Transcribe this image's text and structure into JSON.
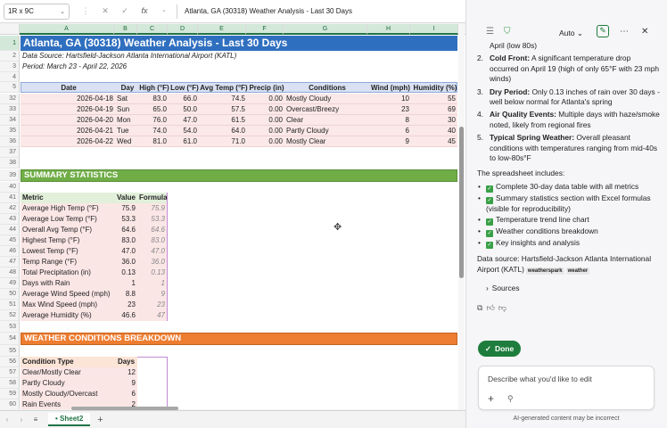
{
  "formula_bar": {
    "name_box": "1R x 9C",
    "formula": "Atlanta, GA (30318) Weather Analysis - Last 30 Days"
  },
  "columns": [
    "A",
    "B",
    "C",
    "D",
    "E",
    "F",
    "G",
    "H",
    "I"
  ],
  "rows": {
    "title": {
      "num": "1",
      "text": "Atlanta, GA (30318) Weather Analysis - Last 30 Days"
    },
    "source": {
      "num": "2",
      "text": "Data Source: Hartsfield-Jackson Atlanta International Airport (KATL)"
    },
    "period": {
      "num": "3",
      "text": "Period: March 23 - April 22, 2026"
    },
    "blank4": {
      "num": "4"
    },
    "header": {
      "num": "5",
      "cols": [
        "Date",
        "Day",
        "High (°F)",
        "Low (°F)",
        "Avg Temp (°F)",
        "Precip (in)",
        "Conditions",
        "Wind (mph)",
        "Humidity (%)"
      ]
    },
    "data": [
      {
        "num": "32",
        "date": "2026-04-18",
        "day": "Sat",
        "high": "83.0",
        "low": "66.0",
        "avg": "74.5",
        "precip": "0.00",
        "cond": "Mostly Cloudy",
        "wind": "10",
        "hum": "55"
      },
      {
        "num": "33",
        "date": "2026-04-19",
        "day": "Sun",
        "high": "65.0",
        "low": "50.0",
        "avg": "57.5",
        "precip": "0.00",
        "cond": "Overcast/Breezy",
        "wind": "23",
        "hum": "69"
      },
      {
        "num": "34",
        "date": "2026-04-20",
        "day": "Mon",
        "high": "76.0",
        "low": "47.0",
        "avg": "61.5",
        "precip": "0.00",
        "cond": "Clear",
        "wind": "8",
        "hum": "30"
      },
      {
        "num": "35",
        "date": "2026-04-21",
        "day": "Tue",
        "high": "74.0",
        "low": "54.0",
        "avg": "64.0",
        "precip": "0.00",
        "cond": "Partly Cloudy",
        "wind": "6",
        "hum": "40"
      },
      {
        "num": "36",
        "date": "2026-04-22",
        "day": "Wed",
        "high": "81.0",
        "low": "61.0",
        "avg": "71.0",
        "precip": "0.00",
        "cond": "Mostly Clear",
        "wind": "9",
        "hum": "45"
      }
    ],
    "blank_rows": [
      "37",
      "38"
    ],
    "summary_title": {
      "num": "39",
      "text": "SUMMARY STATISTICS"
    },
    "blank40": {
      "num": "40"
    },
    "summary_header": {
      "num": "41",
      "metric": "Metric",
      "value": "Value",
      "formula": "Formula"
    },
    "summary": [
      {
        "num": "42",
        "metric": "Average High Temp (°F)",
        "value": "75.9",
        "formula": "75.9"
      },
      {
        "num": "43",
        "metric": "Average Low Temp (°F)",
        "value": "53.3",
        "formula": "53.3"
      },
      {
        "num": "44",
        "metric": "Overall Avg Temp (°F)",
        "value": "64.6",
        "formula": "64.6"
      },
      {
        "num": "45",
        "metric": "Highest Temp (°F)",
        "value": "83.0",
        "formula": "83.0"
      },
      {
        "num": "46",
        "metric": "Lowest Temp (°F)",
        "value": "47.0",
        "formula": "47.0"
      },
      {
        "num": "47",
        "metric": "Temp Range (°F)",
        "value": "36.0",
        "formula": "36.0"
      },
      {
        "num": "48",
        "metric": "Total Precipitation (in)",
        "value": "0.13",
        "formula": "0.13"
      },
      {
        "num": "49",
        "metric": "Days with Rain",
        "value": "1",
        "formula": "1"
      },
      {
        "num": "50",
        "metric": "Average Wind Speed (mph)",
        "value": "8.8",
        "formula": "9"
      },
      {
        "num": "51",
        "metric": "Max Wind Speed (mph)",
        "value": "23",
        "formula": "23"
      },
      {
        "num": "52",
        "metric": "Average Humidity (%)",
        "value": "46.6",
        "formula": "47"
      }
    ],
    "blank53": {
      "num": "53"
    },
    "conditions_title": {
      "num": "54",
      "text": "WEATHER CONDITIONS BREAKDOWN"
    },
    "blank55": {
      "num": "55"
    },
    "conditions_header": {
      "num": "56",
      "type": "Condition Type",
      "days": "Days"
    },
    "conditions": [
      {
        "num": "57",
        "type": "Clear/Mostly Clear",
        "days": "12"
      },
      {
        "num": "58",
        "type": "Partly Cloudy",
        "days": "9"
      },
      {
        "num": "59",
        "type": "Mostly Cloudy/Overcast",
        "days": "6"
      },
      {
        "num": "60",
        "type": "Rain Events",
        "days": "2"
      }
    ]
  },
  "sheet_tabs": {
    "active": "Sheet2",
    "add": "+"
  },
  "copilot": {
    "mode": "Auto",
    "list_top_tail": "April (low 80s)",
    "numbered": [
      {
        "n": "2.",
        "bold": "Cold Front:",
        "text": " A significant temperature drop occurred on April 19 (high of only 65°F with 23 mph winds)"
      },
      {
        "n": "3.",
        "bold": "Dry Period:",
        "text": " Only 0.13 inches of rain over 30 days - well below normal for Atlanta's spring"
      },
      {
        "n": "4.",
        "bold": "Air Quality Events:",
        "text": " Multiple days with haze/smoke noted, likely from regional fires"
      },
      {
        "n": "5.",
        "bold": "Typical Spring Weather:",
        "text": " Overall pleasant conditions with temperatures ranging from mid-40s to low-80s°F"
      }
    ],
    "includes_heading": "The spreadsheet includes:",
    "includes": [
      "Complete 30-day data table with all metrics",
      "Summary statistics section with Excel formulas (visible for reproducibility)",
      "Temperature trend line chart",
      "Weather conditions breakdown",
      "Key insights and analysis"
    ],
    "source_text": "Data source: Hartsfield-Jackson Atlanta International Airport (KATL)",
    "chips": [
      "weatherspark",
      "weather"
    ],
    "sources_label": "Sources",
    "done_label": "Done",
    "input_placeholder": "Describe what you'd like to edit",
    "footer": "AI-generated content may be incorrect"
  }
}
